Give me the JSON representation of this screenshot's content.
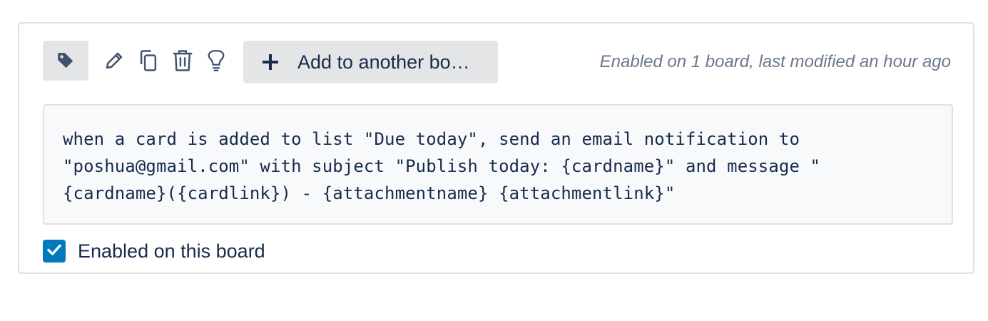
{
  "toolbar": {
    "tag_icon": "tag-icon",
    "edit_icon": "pencil-icon",
    "copy_icon": "copy-icon",
    "delete_icon": "trash-icon",
    "idea_icon": "lightbulb-icon",
    "add_button_label": "Add to another bo…",
    "status": "Enabled on 1 board, last modified an hour ago"
  },
  "rule": {
    "text": "when a card is added to list \"Due today\", send an email notification to\n\"poshua@gmail.com\" with subject \"Publish today: {cardname}\" and message \"\n{cardname}({cardlink}) - {attachmentname} {attachmentlink}\""
  },
  "enabled": {
    "checked": true,
    "label": "Enabled on this board"
  },
  "colors": {
    "accent": "#0079bf",
    "text": "#172b4d",
    "muted": "#6b778c",
    "button_bg": "#e4e5e7",
    "border": "#dfe1e6"
  }
}
